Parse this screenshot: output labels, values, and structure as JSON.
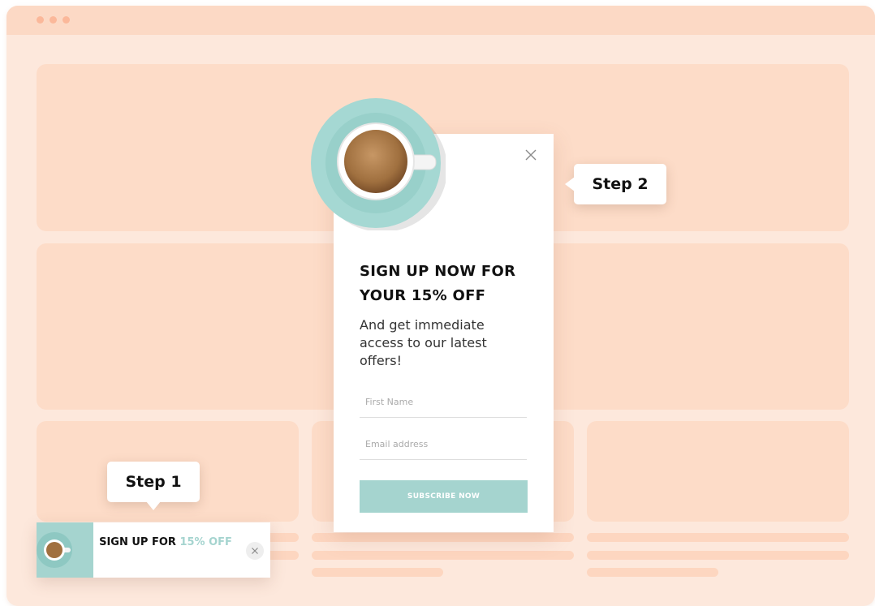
{
  "colors": {
    "page_background": "#fde8dc",
    "content_block": "#fddcc8",
    "accent_teal": "#a5d4cf",
    "titlebar_dot": "#fbb89a"
  },
  "popup": {
    "close_icon": "close-icon",
    "headline": "SIGN UP NOW FOR YOUR 15% OFF",
    "subtext": "And get immediate access to our latest offers!",
    "first_name_placeholder": "First Name",
    "email_placeholder": "Email address",
    "subscribe_label": "SUBSCRIBE NOW",
    "image_icon": "coffee-cup-icon"
  },
  "callouts": {
    "step1": "Step 1",
    "step2": "Step 2"
  },
  "teaser": {
    "text_prefix": "SIGN UP FOR ",
    "text_highlight": "15% OFF",
    "close_icon": "close-icon",
    "image_icon": "coffee-cup-icon"
  }
}
